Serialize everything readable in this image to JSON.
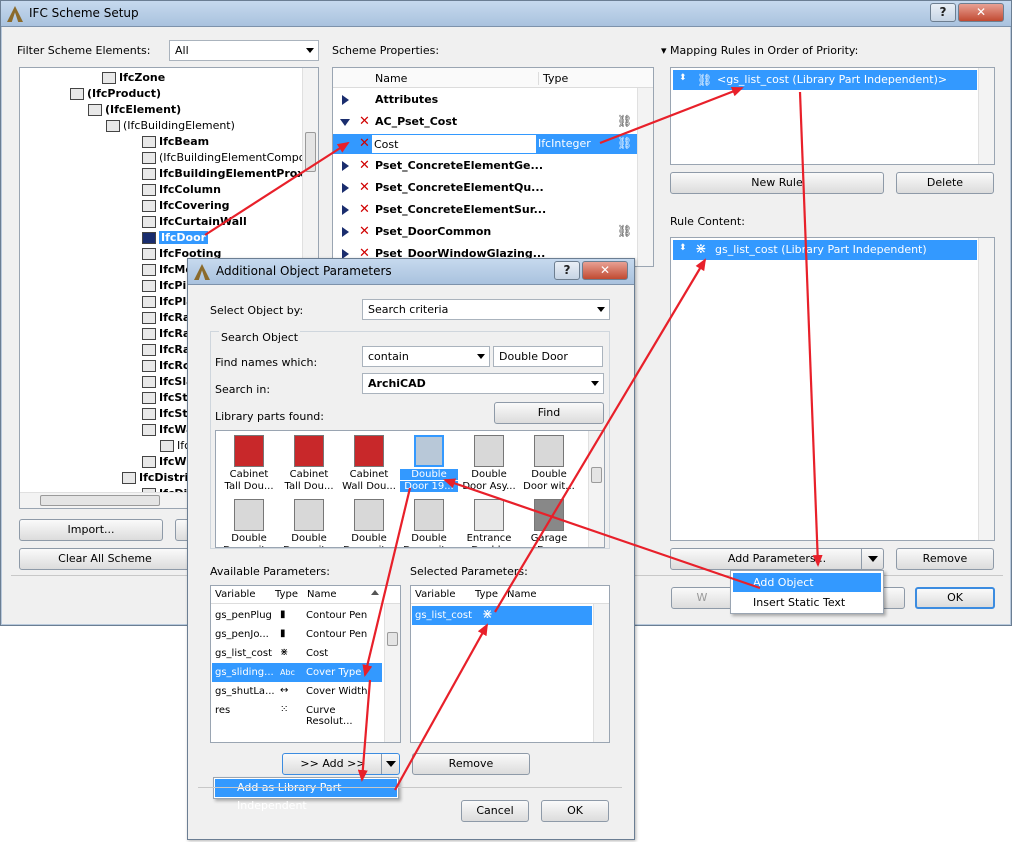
{
  "main_window": {
    "title": "IFC Scheme Setup",
    "help_btn": "?",
    "close_btn": "✕",
    "filter_label": "Filter Scheme Elements:",
    "filter_value": "All",
    "scheme_props_label": "Scheme Properties:",
    "mapping_label": "Mapping Rules in Order of Priority:",
    "rule_content_label": "Rule Content:",
    "tree_items": [
      {
        "label": "IfcZone",
        "bold": true
      },
      {
        "label": "(IfcProduct)",
        "bold": true
      },
      {
        "label": "(IfcElement)",
        "bold": true
      },
      {
        "label": "(IfcBuildingElement)",
        "bold": false
      },
      {
        "label": "IfcBeam",
        "bold": true
      },
      {
        "label": "(IfcBuildingElementComponen",
        "bold": false
      },
      {
        "label": "IfcBuildingElementProxy",
        "bold": true
      },
      {
        "label": "IfcColumn",
        "bold": true
      },
      {
        "label": "IfcCovering",
        "bold": true
      },
      {
        "label": "IfcCurtainWall",
        "bold": true
      },
      {
        "label": "IfcDoor",
        "bold": true
      },
      {
        "label": "IfcFooting",
        "bold": true
      },
      {
        "label": "IfcMe",
        "bold": true
      },
      {
        "label": "IfcPil",
        "bold": true
      },
      {
        "label": "IfcPla",
        "bold": true
      },
      {
        "label": "IfcRa",
        "bold": true
      },
      {
        "label": "IfcRa",
        "bold": true
      },
      {
        "label": "IfcRa",
        "bold": true
      },
      {
        "label": "IfcRo",
        "bold": true
      },
      {
        "label": "IfcSla",
        "bold": true
      },
      {
        "label": "IfcSta",
        "bold": true
      },
      {
        "label": "IfcSta",
        "bold": true
      },
      {
        "label": "IfcWa",
        "bold": true
      },
      {
        "label": "Ifc",
        "bold": false
      },
      {
        "label": "IfcWi",
        "bold": true
      },
      {
        "label": "IfcDistri",
        "bold": true
      },
      {
        "label": "IfcDis",
        "bold": true
      }
    ],
    "import_btn": "Import...",
    "clear_btn": "Clear All Scheme",
    "col_name": "Name",
    "col_type": "Type",
    "props": [
      {
        "name": "Attributes",
        "type": "",
        "x": false,
        "open": false
      },
      {
        "name": "AC_Pset_Cost",
        "type": "",
        "x": true,
        "open": true
      },
      {
        "name": "Cost",
        "type": "IfcInteger",
        "x": true,
        "child": true
      },
      {
        "name": "Pset_ConcreteElementGe...",
        "type": "",
        "x": true
      },
      {
        "name": "Pset_ConcreteElementQu...",
        "type": "",
        "x": true
      },
      {
        "name": "Pset_ConcreteElementSur...",
        "type": "",
        "x": true
      },
      {
        "name": "Pset_DoorCommon",
        "type": "",
        "x": true
      },
      {
        "name": "Pset_DoorWindowGlazing...",
        "type": "",
        "x": true
      }
    ],
    "mapping_rule": "<gs_list_cost (Library Part Independent)>",
    "new_rule_btn": "New Rule",
    "delete_btn": "Delete",
    "rule_content": "gs_list_cost (Library Part Independent)",
    "add_params_btn": "Add Parameters...",
    "remove_btn": "Remove",
    "menu_items": [
      "Add Object Parameters...",
      "Insert Static Text"
    ],
    "w_btn": "W",
    "ok_btn": "OK"
  },
  "dialog": {
    "title": "Additional Object Parameters",
    "help_btn": "?",
    "close_btn": "✕",
    "select_by_label": "Select Object by:",
    "select_by_value": "Search criteria",
    "search_group": "Search Object",
    "find_names_label": "Find names which:",
    "find_op": "contain",
    "find_text": "Double Door",
    "search_in_label": "Search in:",
    "search_in_value": "ArchiCAD",
    "lib_found_label": "Library parts found:",
    "find_btn": "Find",
    "library_parts": [
      {
        "l1": "Cabinet",
        "l2": "Tall Dou...",
        "color": "#c8282a"
      },
      {
        "l1": "Cabinet",
        "l2": "Tall Dou...",
        "color": "#c8282a"
      },
      {
        "l1": "Cabinet",
        "l2": "Wall Dou...",
        "color": "#c8282a"
      },
      {
        "l1": "Double",
        "l2": "Door 19...",
        "color": "#b8c8d8",
        "sel": true
      },
      {
        "l1": "Double",
        "l2": "Door Asy...",
        "color": "#d8d8d8"
      },
      {
        "l1": "Double",
        "l2": "Door wit...",
        "color": "#d8d8d8"
      },
      {
        "l1": "Double",
        "l2": "Door wit...",
        "color": "#d8d8d8"
      },
      {
        "l1": "Double",
        "l2": "Door wit...",
        "color": "#d8d8d8"
      },
      {
        "l1": "Double",
        "l2": "Door wit...",
        "color": "#d8d8d8"
      },
      {
        "l1": "Double",
        "l2": "Door wit...",
        "color": "#d8d8d8"
      },
      {
        "l1": "Entrance",
        "l2": "Double",
        "color": "#e8e8e8"
      },
      {
        "l1": "Garage",
        "l2": "Door",
        "color": "#888888"
      }
    ],
    "available_label": "Available Parameters:",
    "selected_label": "Selected Parameters:",
    "avail_cols": [
      "Variable",
      "Type",
      "Name"
    ],
    "available": [
      {
        "var": "gs_penPlug",
        "icon": "pen-icon",
        "name": "Contour Pen"
      },
      {
        "var": "gs_penJo...",
        "icon": "pen-icon",
        "name": "Contour Pen"
      },
      {
        "var": "gs_list_cost",
        "icon": "list-icon",
        "name": "Cost"
      },
      {
        "var": "gs_sliding...",
        "icon": "abc-icon",
        "name": "Cover Type",
        "sel": true
      },
      {
        "var": "gs_shutLa...",
        "icon": "width-icon",
        "name": "Cover Width"
      },
      {
        "var": "res",
        "icon": "grid-icon",
        "name": "Curve Resolut..."
      }
    ],
    "sel_cols": [
      "Variable",
      "Type",
      "Name"
    ],
    "selected": [
      {
        "var": "gs_list_cost",
        "icon": "list-icon",
        "name": ""
      }
    ],
    "add_btn": ">> Add >>",
    "remove_btn": "Remove",
    "add_menu_item": "Add as Library Part Independent",
    "cancel_btn": "Cancel",
    "ok_btn": "OK"
  },
  "colors": {
    "selection": "#3399ff",
    "arrow": "#e8202a",
    "title_bar": "#b9cfe8"
  }
}
